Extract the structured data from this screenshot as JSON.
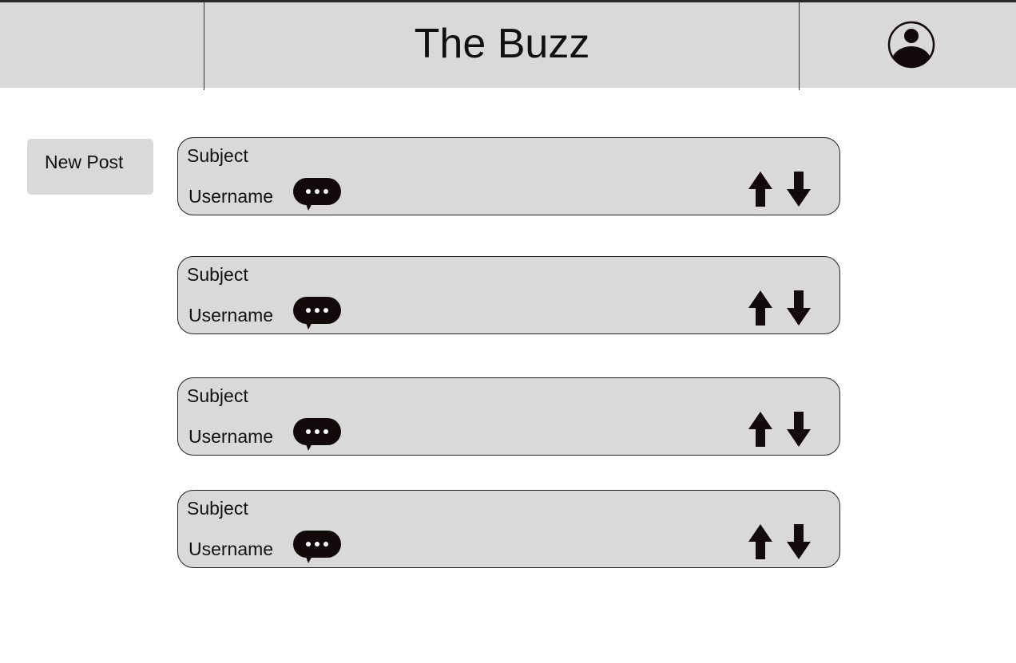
{
  "header": {
    "title": "The Buzz",
    "profile_icon": "user-circle-icon"
  },
  "sidebar": {
    "new_post_label": "New Post"
  },
  "posts": [
    {
      "subject": "Subject",
      "username": "Username"
    },
    {
      "subject": "Subject",
      "username": "Username"
    },
    {
      "subject": "Subject",
      "username": "Username"
    },
    {
      "subject": "Subject",
      "username": "Username"
    }
  ],
  "icons": {
    "comment": "speech-bubble-icon",
    "upvote": "arrow-up-icon",
    "downvote": "arrow-down-icon"
  },
  "colors": {
    "panel": "#d9d9d9",
    "icon": "#120a0a",
    "text": "#111111"
  }
}
